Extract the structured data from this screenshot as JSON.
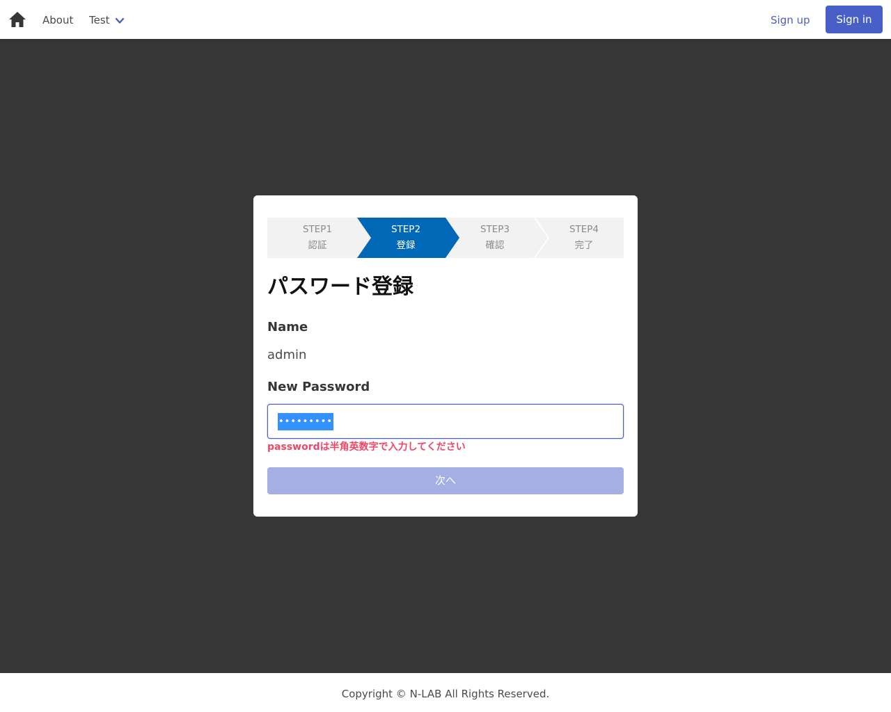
{
  "navbar": {
    "home_icon": "home-icon",
    "about_label": "About",
    "test_label": "Test",
    "signup_label": "Sign up",
    "signin_label": "Sign in"
  },
  "steps": [
    {
      "step": "STEP1",
      "label": "認証",
      "active": false
    },
    {
      "step": "STEP2",
      "label": "登録",
      "active": true
    },
    {
      "step": "STEP3",
      "label": "確認",
      "active": false
    },
    {
      "step": "STEP4",
      "label": "完了",
      "active": false
    }
  ],
  "form": {
    "title": "パスワード登録",
    "name_label": "Name",
    "name_value": "admin",
    "password_label": "New Password",
    "password_value": "•••••••••",
    "error_message": "passwordは半角英数字で入力してください",
    "next_label": "次へ"
  },
  "footer": {
    "copyright": "Copyright © N-LAB All Rights Reserved."
  },
  "colors": {
    "primary": "#485fc7",
    "active_step": "#0068b7",
    "inactive_step": "#f2f2f2",
    "error": "#f14668",
    "disabled_button": "#a4afe3",
    "background": "#363636"
  }
}
